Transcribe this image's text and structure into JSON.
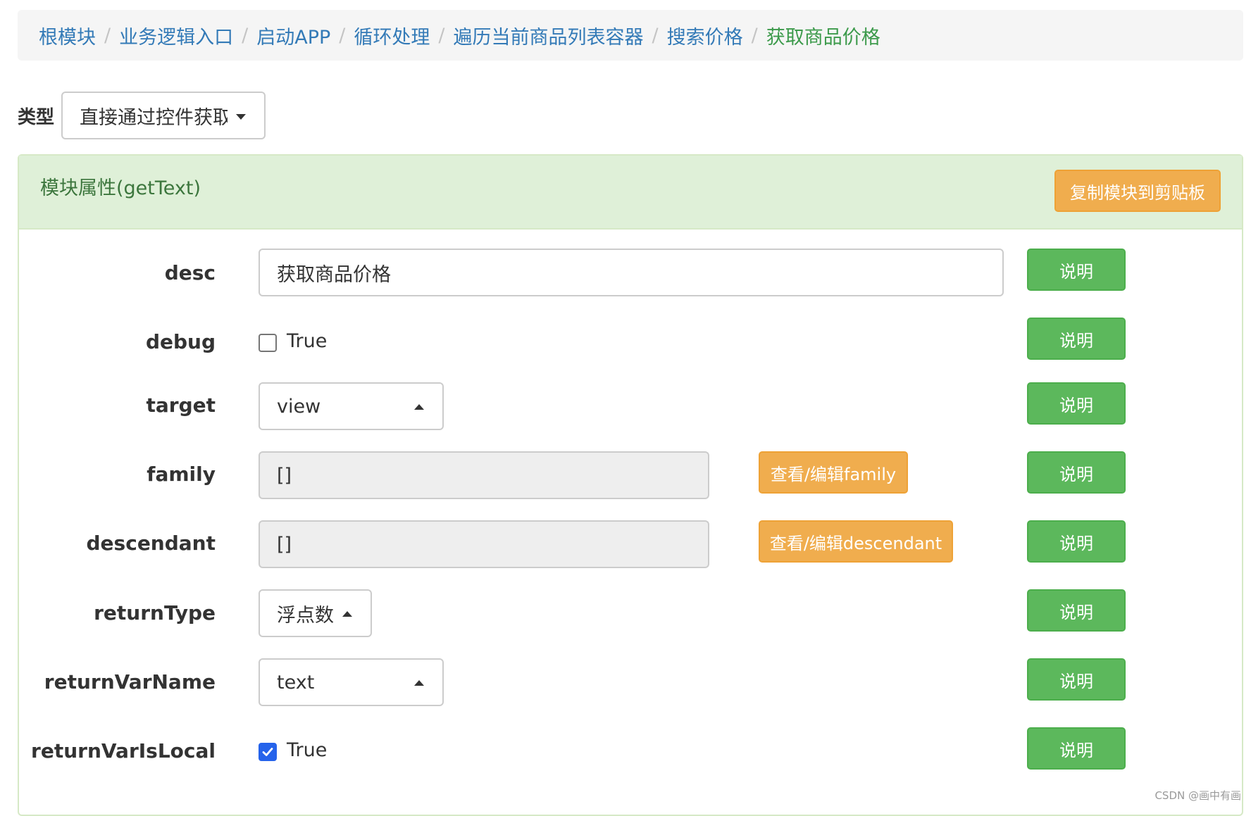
{
  "breadcrumb": {
    "items": [
      "根模块",
      "业务逻辑入口",
      "启动APP",
      "循环处理",
      "遍历当前商品列表容器",
      "搜索价格",
      "获取商品价格"
    ],
    "separator": "/"
  },
  "type_selector": {
    "label": "类型",
    "value": "直接通过控件获取"
  },
  "panel": {
    "title": "模块属性(getText)",
    "copy_button": "复制模块到剪贴板"
  },
  "fields": {
    "desc": {
      "label": "desc",
      "value": "获取商品价格",
      "help": "说明"
    },
    "debug": {
      "label": "debug",
      "checkbox_text": "True",
      "checked": false,
      "help": "说明"
    },
    "target": {
      "label": "target",
      "value": "view",
      "help": "说明"
    },
    "family": {
      "label": "family",
      "value": "[]",
      "edit_button": "查看/编辑family",
      "help": "说明"
    },
    "descendant": {
      "label": "descendant",
      "value": "[]",
      "edit_button": "查看/编辑descendant",
      "help": "说明"
    },
    "returnType": {
      "label": "returnType",
      "value": "浮点数",
      "help": "说明"
    },
    "returnVarName": {
      "label": "returnVarName",
      "value": "text",
      "help": "说明"
    },
    "returnVarIsLocal": {
      "label": "returnVarIsLocal",
      "checkbox_text": "True",
      "checked": true,
      "help": "说明"
    }
  },
  "watermark": "CSDN @画中有画",
  "colors": {
    "link": "#337ab7",
    "active_crumb": "#3c9a4b",
    "panel_heading_bg": "#dff0d8",
    "warning": "#f0ad4e",
    "success": "#5cb85c",
    "checkbox_checked": "#2563eb"
  }
}
